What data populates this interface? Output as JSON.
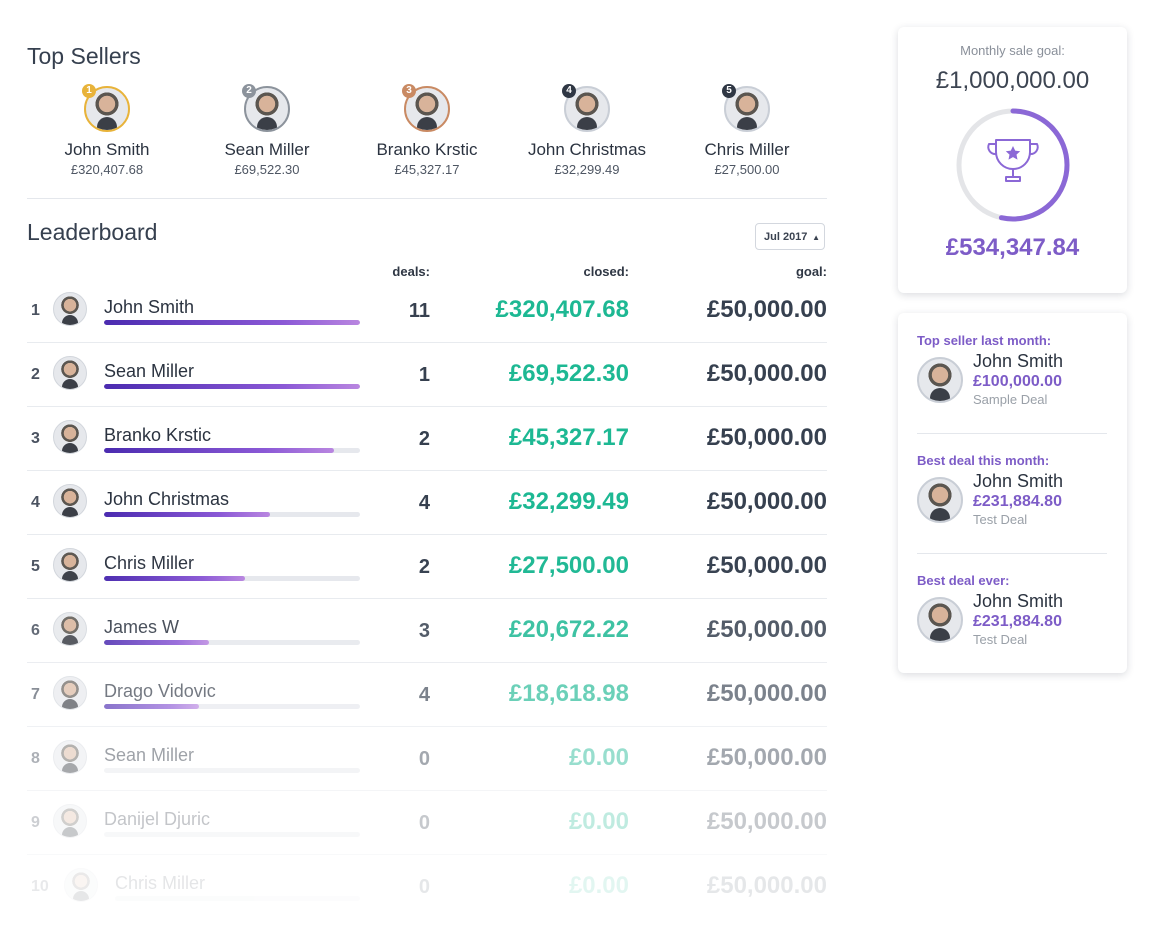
{
  "headings": {
    "top_sellers": "Top Sellers",
    "leaderboard": "Leaderboard"
  },
  "top_sellers": [
    {
      "rank": "1",
      "name": "John Smith",
      "amount": "£320,407.68",
      "ring": "#e8b33a"
    },
    {
      "rank": "2",
      "name": "Sean Miller",
      "amount": "£69,522.30",
      "ring": "#8c939c"
    },
    {
      "rank": "3",
      "name": "Branko Krstic",
      "amount": "£45,327.17",
      "ring": "#c98a63"
    },
    {
      "rank": "4",
      "name": "John Christmas",
      "amount": "£32,299.49",
      "ring": "#c9ced6"
    },
    {
      "rank": "5",
      "name": "Chris Miller",
      "amount": "£27,500.00",
      "ring": "#c9ced6"
    }
  ],
  "month_select": {
    "value": "Jul 2017"
  },
  "columns": {
    "deals": "deals:",
    "closed": "closed:",
    "goal": "goal:"
  },
  "leaderboard": [
    {
      "rank": "1",
      "name": "John Smith",
      "deals": "11",
      "closed": "£320,407.68",
      "goal": "£50,000.00",
      "progress": 1.0
    },
    {
      "rank": "2",
      "name": "Sean Miller",
      "deals": "1",
      "closed": "£69,522.30",
      "goal": "£50,000.00",
      "progress": 1.0
    },
    {
      "rank": "3",
      "name": "Branko Krstic",
      "deals": "2",
      "closed": "£45,327.17",
      "goal": "£50,000.00",
      "progress": 0.9
    },
    {
      "rank": "4",
      "name": "John Christmas",
      "deals": "4",
      "closed": "£32,299.49",
      "goal": "£50,000.00",
      "progress": 0.65
    },
    {
      "rank": "5",
      "name": "Chris Miller",
      "deals": "2",
      "closed": "£27,500.00",
      "goal": "£50,000.00",
      "progress": 0.55
    },
    {
      "rank": "6",
      "name": "James W",
      "deals": "3",
      "closed": "£20,672.22",
      "goal": "£50,000.00",
      "progress": 0.41
    },
    {
      "rank": "7",
      "name": "Drago Vidovic",
      "deals": "4",
      "closed": "£18,618.98",
      "goal": "£50,000.00",
      "progress": 0.37
    },
    {
      "rank": "8",
      "name": "Sean Miller",
      "deals": "0",
      "closed": "£0.00",
      "goal": "£50,000.00",
      "progress": 0
    },
    {
      "rank": "9",
      "name": "Danijel Djuric",
      "deals": "0",
      "closed": "£0.00",
      "goal": "£50,000.00",
      "progress": 0
    },
    {
      "rank": "10",
      "name": "Chris Miller",
      "deals": "0",
      "closed": "£0.00",
      "goal": "£50,000.00",
      "progress": 0
    }
  ],
  "monthly_goal": {
    "label": "Monthly sale goal:",
    "goal": "£1,000,000.00",
    "current": "£534,347.84",
    "progress": 0.534
  },
  "highlights": [
    {
      "title": "Top seller last month:",
      "name": "John Smith",
      "value": "£100,000.00",
      "deal": "Sample Deal"
    },
    {
      "title": "Best deal this month:",
      "name": "John Smith",
      "value": "£231,884.80",
      "deal": "Test Deal"
    },
    {
      "title": "Best deal ever:",
      "name": "John Smith",
      "value": "£231,884.80",
      "deal": "Test Deal"
    }
  ],
  "colors": {
    "accent": "#7d5cc7",
    "money": "#1db893",
    "text": "#36404f"
  }
}
